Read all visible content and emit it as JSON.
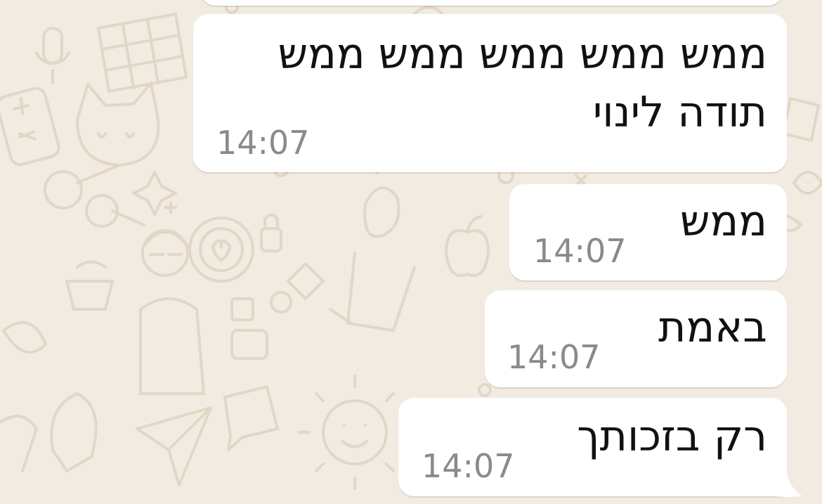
{
  "chat": {
    "messages": [
      {
        "id": "m1",
        "lines": [
          "ממש ממש ממש ממש ממש",
          "תודה לינוי"
        ],
        "time": "14:07"
      },
      {
        "id": "m2",
        "lines": [
          "ממש"
        ],
        "time": "14:07"
      },
      {
        "id": "m3",
        "lines": [
          "באמת"
        ],
        "time": "14:07"
      },
      {
        "id": "m4",
        "lines": [
          "רק בזכותך"
        ],
        "time": "14:07"
      }
    ]
  },
  "colors": {
    "wallpaper": "#f1ebe1",
    "doodle": "#e2d7c6",
    "bubble": "#ffffff",
    "text": "#111111",
    "timestamp": "#8a8a8a"
  }
}
